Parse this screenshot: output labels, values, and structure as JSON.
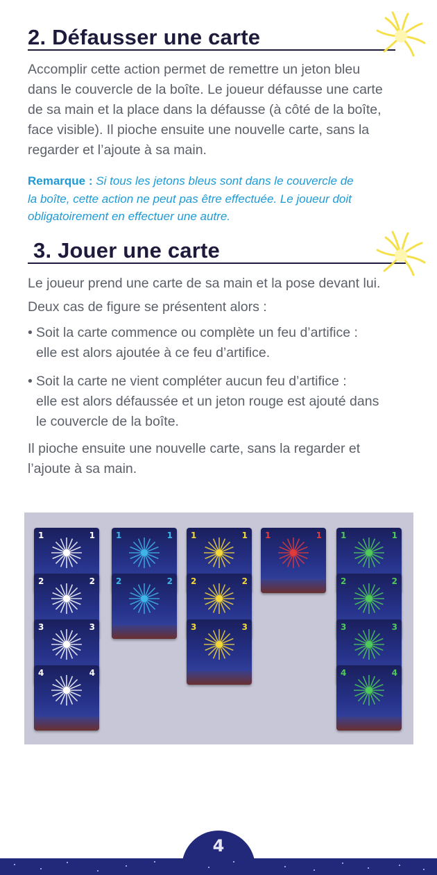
{
  "section2": {
    "title": "2. Défausser une carte",
    "lines": [
      "Accomplir cette action permet de remettre un jeton bleu",
      "dans le couvercle de la boîte. Le joueur défausse une carte",
      "de sa main et la place dans la défausse (à côté de la boîte,",
      "face visible). Il pioche ensuite une nouvelle carte, sans la",
      "regarder et l’ajoute à sa main."
    ],
    "note": {
      "label": "Remarque :",
      "line1": " Si tous les jetons bleus sont dans le couvercle de",
      "line2": "la boîte, cette action ne peut pas être effectuée. Le joueur doit",
      "line3": "obligatoirement en effectuer une autre."
    }
  },
  "section3": {
    "title": "3. Jouer une carte",
    "intro1": "Le joueur prend une carte de sa main et la pose devant lui.",
    "intro2": "Deux cas de figure se présentent alors :",
    "bullets": [
      {
        "marker": "•",
        "lines": [
          "Soit la carte commence ou complète un feu d’artifice :",
          "elle est alors ajoutée à ce feu d’artifice."
        ]
      },
      {
        "marker": "•",
        "lines": [
          "Soit la carte ne vient compléter aucun feu d’artifice :",
          "elle est alors défaussée et un jeton rouge est ajouté dans",
          "le couvercle de la boîte."
        ]
      }
    ],
    "outro": [
      "Il pioche ensuite une nouvelle carte, sans la regarder et",
      "l’ajoute à sa main."
    ]
  },
  "illustration": {
    "columns": [
      {
        "color_name": "white",
        "color": "#ffffff",
        "numbers": [
          "1",
          "2",
          "3",
          "4"
        ]
      },
      {
        "color_name": "blue",
        "color": "#3fb4e8",
        "numbers": [
          "1",
          "2"
        ]
      },
      {
        "color_name": "yellow",
        "color": "#f2d63a",
        "numbers": [
          "1",
          "2",
          "3"
        ]
      },
      {
        "color_name": "red",
        "color": "#e03a3a",
        "numbers": [
          "1"
        ]
      },
      {
        "color_name": "green",
        "color": "#4fc95a",
        "numbers": [
          "1",
          "2",
          "3",
          "4"
        ]
      }
    ],
    "board_color": "#c7c7d8"
  },
  "footer": {
    "page_number": "4",
    "band_color": "#22287a"
  },
  "colors": {
    "title": "#1d1a3c",
    "body": "#5a5f68",
    "note": "#1d9ad6",
    "firework": "#f5e04a"
  },
  "icons": {
    "title_decoration": "firework-icon"
  }
}
